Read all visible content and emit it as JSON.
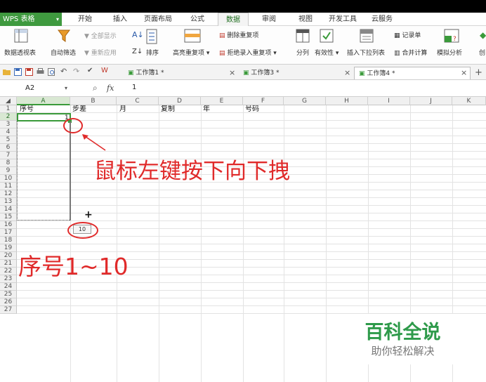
{
  "app": {
    "name": "WPS 表格"
  },
  "menu": {
    "tabs": [
      "开始",
      "插入",
      "页面布局",
      "公式",
      "数据",
      "审阅",
      "视图",
      "开发工具",
      "云服务"
    ],
    "active": "数据"
  },
  "ribbon": {
    "pivot": "数据透视表",
    "autofilter": "自动筛选",
    "show_all": "全部显示",
    "reapply": "重新应用",
    "sort": "排序",
    "highlight_dup": "高亮重复项",
    "delete_dup": "删除重复项",
    "reject_dup": "拒绝录入重复项",
    "split": "分列",
    "validity": "有效性",
    "insert_dropdown": "插入下拉列表",
    "record": "记录单",
    "consolidate": "合并计算",
    "simulate": "模拟分析",
    "create": "创"
  },
  "workbooks": {
    "tabs": [
      "工作簿1 *",
      "工作簿3 *",
      "工作簿4 *"
    ],
    "active_index": 2,
    "close_glyph": "×",
    "new_tab_glyph": "+"
  },
  "formula": {
    "cell_ref": "A2",
    "fx": "fx",
    "value": "1"
  },
  "grid": {
    "columns": [
      "A",
      "B",
      "C",
      "D",
      "E",
      "F",
      "G",
      "H",
      "I",
      "J",
      "K"
    ],
    "rows": [
      "1",
      "2",
      "3",
      "4",
      "5",
      "6",
      "7",
      "8",
      "9",
      "10",
      "11",
      "12",
      "13",
      "14",
      "15",
      "16",
      "17",
      "18",
      "19",
      "20",
      "21",
      "22",
      "23",
      "24",
      "25",
      "26",
      "27"
    ],
    "headers": [
      "序号",
      "步差",
      "月",
      "复制",
      "年",
      "号码"
    ],
    "fill_hint": "10",
    "fill_cursor": "+"
  },
  "annotations": {
    "drag_instruction": "鼠标左键按下向下拽",
    "sequence": "序号1~10",
    "color": "#e02a2a"
  },
  "watermark": {
    "title": "百科全说",
    "subtitle": "助你轻松解决"
  },
  "colors": {
    "app_green": "#3f9a3f",
    "selection_green": "#3a9a3a",
    "annotation_red": "#e02a2a"
  }
}
